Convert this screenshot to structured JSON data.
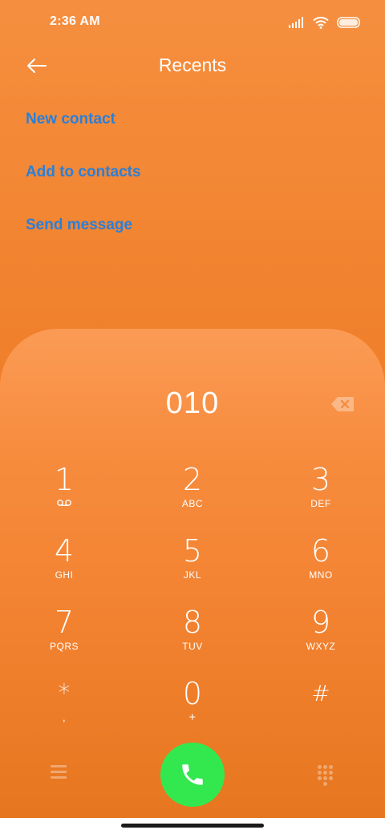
{
  "status_bar": {
    "time": "2:36 AM",
    "icons": [
      "signal-icon",
      "wifi-icon",
      "battery-icon"
    ]
  },
  "header": {
    "title": "Recents",
    "back_icon": "back-arrow-icon"
  },
  "actions": [
    {
      "label": "New contact"
    },
    {
      "label": "Add to contacts"
    },
    {
      "label": "Send message"
    }
  ],
  "dialpad": {
    "number": "010",
    "backspace_icon": "backspace-icon",
    "keys": [
      {
        "digit": "1",
        "letters": "",
        "sub_icon": "voicemail-icon"
      },
      {
        "digit": "2",
        "letters": "ABC"
      },
      {
        "digit": "3",
        "letters": "DEF"
      },
      {
        "digit": "4",
        "letters": "GHI"
      },
      {
        "digit": "5",
        "letters": "JKL"
      },
      {
        "digit": "6",
        "letters": "MNO"
      },
      {
        "digit": "7",
        "letters": "PQRS"
      },
      {
        "digit": "8",
        "letters": "TUV"
      },
      {
        "digit": "9",
        "letters": "WXYZ"
      },
      {
        "digit": "*",
        "letters": ","
      },
      {
        "digit": "0",
        "letters": "+"
      },
      {
        "digit": "#",
        "letters": ""
      }
    ]
  },
  "bottom_bar": {
    "menu_icon": "menu-icon",
    "call_icon": "phone-icon",
    "dialpad_icon": "dialpad-icon"
  },
  "colors": {
    "accent_link": "#2b7fd8",
    "call_button": "#33e84f",
    "background": "#f07f2a"
  }
}
